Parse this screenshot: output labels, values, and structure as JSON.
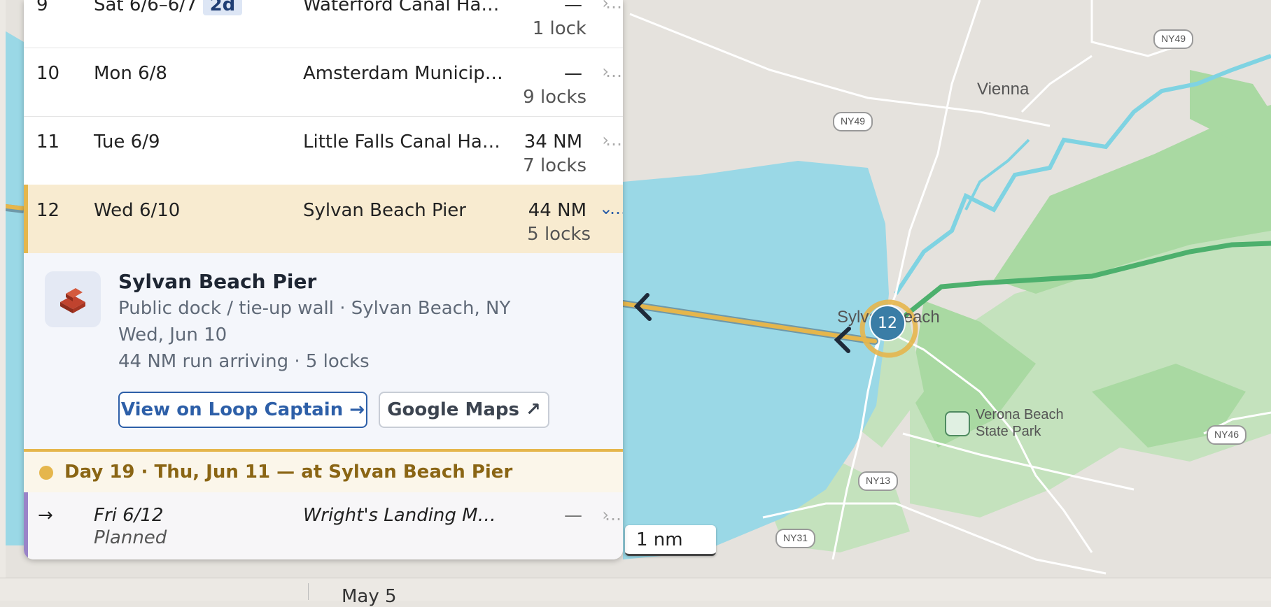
{
  "rows": [
    {
      "num": "9",
      "date": "Sat 6/6–6/7",
      "badge": "2d",
      "dest": "Waterford Canal Harbor",
      "dist": "—",
      "locks": "1 lock"
    },
    {
      "num": "10",
      "date": "Mon 6/8",
      "dest": "Amsterdam Municipal Marina",
      "dist": "—",
      "locks": "9 locks"
    },
    {
      "num": "11",
      "date": "Tue 6/9",
      "dest": "Little Falls Canal Harbor",
      "dist": "34 NM",
      "locks": "7 locks"
    },
    {
      "num": "12",
      "date": "Wed 6/10",
      "dest": "Sylvan Beach Pier",
      "dist": "44 NM",
      "locks": "5 locks"
    }
  ],
  "row_icons": {
    "collapsed": "›",
    "expanded": "⌄",
    "more": "…"
  },
  "detail": {
    "title": "Sylvan Beach Pier",
    "type_location": "Public dock / tie-up wall · Sylvan Beach, NY",
    "date": "Wed, Jun 10",
    "summary": "44 NM run arriving · 5 locks",
    "primary_button": "View on Loop Captain →",
    "secondary_button": "Google Maps ↗"
  },
  "day_band": {
    "text": "Day 19 · Thu, Jun 11 — at Sylvan Beach Pier"
  },
  "planned_row": {
    "arrow": "→",
    "date": "Fri 6/12",
    "status": "Planned",
    "dest": "Wright's Landing Marina",
    "dist": "—"
  },
  "map": {
    "scale": "1 nm",
    "labels": {
      "vienna": "Vienna",
      "sylvan_beach": "Sylvan Beach",
      "verona": "Verona Beach",
      "state_park": "State Park"
    },
    "shields": {
      "ny49_top": "NY49",
      "ny49_mid": "NY49",
      "ny46": "NY46",
      "ny13": "NY13",
      "ny31": "NY31"
    },
    "marker_number": "12"
  },
  "bottom": {
    "text": "May 5"
  },
  "colors": {
    "water": "#9ad8e6",
    "route_planned": "#e5b64c",
    "route_future": "#4db06d",
    "park": "#a9d9a2",
    "marker": "#3a7da6"
  }
}
